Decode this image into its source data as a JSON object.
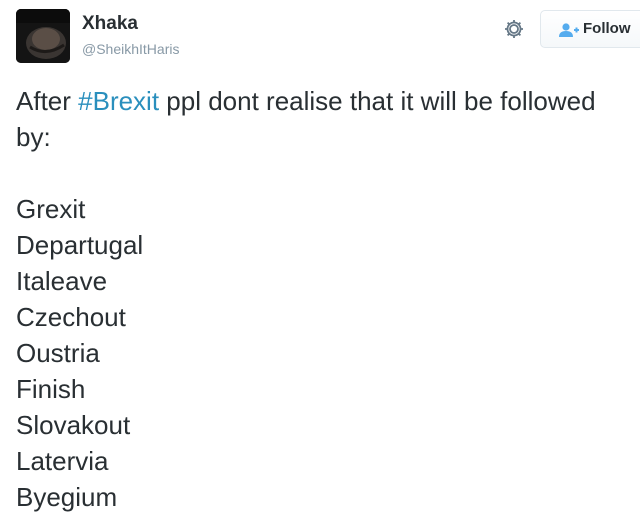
{
  "user": {
    "display_name": "Xhaka",
    "handle": "@SheikhItHaris",
    "avatar_icon": "profile-photo"
  },
  "actions": {
    "settings_icon": "gear-icon",
    "follow_icon": "add-person-icon",
    "follow_label": "Follow"
  },
  "tweet": {
    "text_before": "After ",
    "hashtag": "#Brexit",
    "text_after": " ppl dont realise that it will be followed by:",
    "list": [
      "Grexit",
      "Departugal",
      "Italeave",
      "Czechout",
      "Oustria",
      "Finish",
      "Slovakout",
      "Latervia",
      "Byegium"
    ]
  },
  "colors": {
    "hashtag": "#2a8fbd",
    "text": "#292f33",
    "muted": "#8899a6"
  }
}
